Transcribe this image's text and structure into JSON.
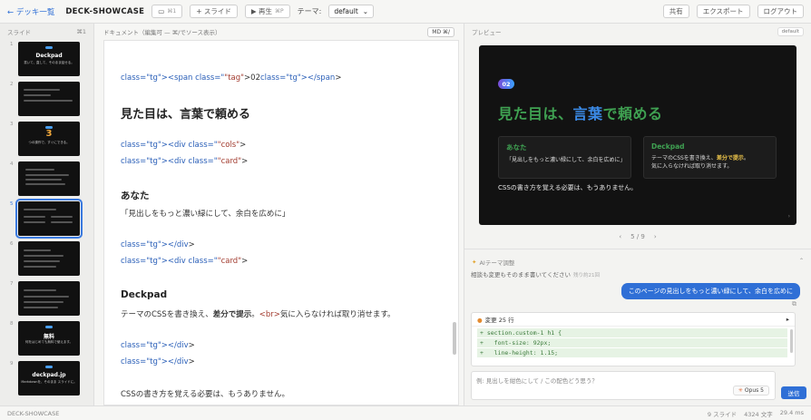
{
  "topbar": {
    "back_label": "← デッキ一覧",
    "deck_name": "DECK-SHOWCASE",
    "undo_label": "⌘1",
    "add_slide_label": "+ スライド",
    "play_label": "▶ 再生",
    "play_shortcut": "⌘P",
    "theme_label": "テーマ:",
    "theme_value": "default",
    "share_label": "共有",
    "export_label": "エクスポート",
    "logout_label": "ログアウト"
  },
  "slides_panel": {
    "title": "スライド",
    "shortcut": "⌘1",
    "active_index": 4,
    "thumbs": [
      {
        "num": "1",
        "title": "Deckpad",
        "sub": "書いて、直して、そのまま話せる。"
      },
      {
        "num": "2",
        "title": "",
        "sub": ""
      },
      {
        "num": "3",
        "title": "3",
        "sub": "つの操作で、すぐにできる。"
      },
      {
        "num": "4",
        "title": "",
        "sub": ""
      },
      {
        "num": "5",
        "title": "",
        "sub": ""
      },
      {
        "num": "6",
        "title": "",
        "sub": ""
      },
      {
        "num": "7",
        "title": "",
        "sub": ""
      },
      {
        "num": "8",
        "title": "無料",
        "sub": "何をはじめても無料で使えます。"
      },
      {
        "num": "9",
        "title": "deckpad.jp",
        "sub": "Markdownを、そのまま スライドに。"
      }
    ]
  },
  "editor": {
    "title": "ドキュメント（編集可 — ⌘/でソース表示）",
    "md_toggle": "MD ⌘/",
    "tag_prefix": "<span class=\"tag\">02</span>",
    "heading": "見た目は、言葉で頼める",
    "div_cols": "<div class=\"cols\">",
    "div_card1": "<div class=\"card\">",
    "anata": "あなた",
    "anata_body": "「見出しをもっと濃い緑にして、余白を広めに」",
    "div_close1": "</div>",
    "div_card2": "<div class=\"card\">",
    "deckpad": "Deckpad",
    "deckpad_body": "テーマのCSSを書き換え、差分で提示。<br>気に入らなければ取り消せます。",
    "div_close2": "</div>",
    "div_close3": "</div>",
    "footer_text": "CSSの書き方を覚える必要は、もうありません。"
  },
  "preview": {
    "title": "プレビュー",
    "theme_badge": "default",
    "slide": {
      "tag": "02",
      "title_a": "見た目は、",
      "title_b": "言葉",
      "title_c": "で頼める",
      "card1_title": "あなた",
      "card1_body": "「見出しをもっと濃い緑にして、余白を広めに」",
      "card2_title": "Deckpad",
      "card2_body_a": "テーマのCSSを書き換え、",
      "card2_body_bold": "差分で提示",
      "card2_body_b": "。",
      "card2_body_c": "気に入らなければ取り消せます。",
      "footer": "CSSの書き方を覚える必要は、もうありません。"
    },
    "pager": {
      "prev": "‹",
      "current": "5 / 9",
      "next": "›"
    }
  },
  "ai": {
    "title": "AIテーマ調整",
    "hint": "相談も変更もそのまま書いてください",
    "hint_note": "残り約21回",
    "user_message": "このページの見出しをもっと濃い緑にして、余白を広めに",
    "change_title": "変更 25 行",
    "diff": [
      "+ section.custom-1 h1 {",
      "+   font-size: 92px;",
      "+   line-height: 1.15;"
    ],
    "input_placeholder": "例: 見出しを紺色にして / この配色どう思う？",
    "model_label": "Opus 5",
    "send_label": "送信"
  },
  "statusbar": {
    "deck": "DECK-SHOWCASE",
    "slides": "9 スライド",
    "chars": "4324 文字",
    "time": "29.4 ms"
  },
  "colors": {
    "accent": "#2f6fd6",
    "slide_green": "#3fa152",
    "slide_bg": "#121212"
  }
}
